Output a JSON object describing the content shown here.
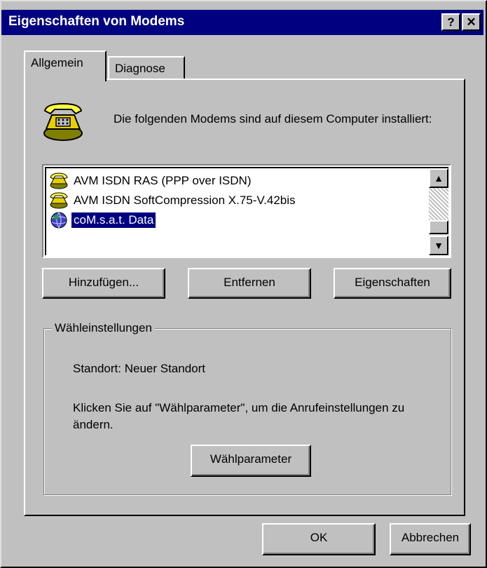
{
  "window": {
    "title": "Eigenschaften von Modems",
    "help_button": "?",
    "close_button": "✕"
  },
  "tabs": [
    {
      "label": "Allgemein",
      "active": true
    },
    {
      "label": "Diagnose",
      "active": false
    }
  ],
  "main": {
    "icon": "telephone-icon",
    "intro_text": "Die folgenden Modems sind auf diesem Computer installiert:",
    "modems": [
      {
        "label": "AVM ISDN RAS (PPP over ISDN)",
        "icon": "modem-icon",
        "selected": false
      },
      {
        "label": "AVM ISDN SoftCompression X.75-V.42bis",
        "icon": "modem-icon",
        "selected": false
      },
      {
        "label": "coM.s.a.t. Data",
        "icon": "globe-modem-icon",
        "selected": true
      }
    ],
    "buttons": {
      "add": "Hinzufügen...",
      "remove": "Entfernen",
      "properties": "Eigenschaften"
    }
  },
  "dial_settings": {
    "legend": "Wähleinstellungen",
    "location_label": "Standort: Neuer Standort",
    "hint": "Klicken Sie auf \"Wählparameter\", um die Anrufeinstellungen zu ändern.",
    "button": "Wählparameter"
  },
  "footer": {
    "ok": "OK",
    "cancel": "Abbrechen"
  }
}
